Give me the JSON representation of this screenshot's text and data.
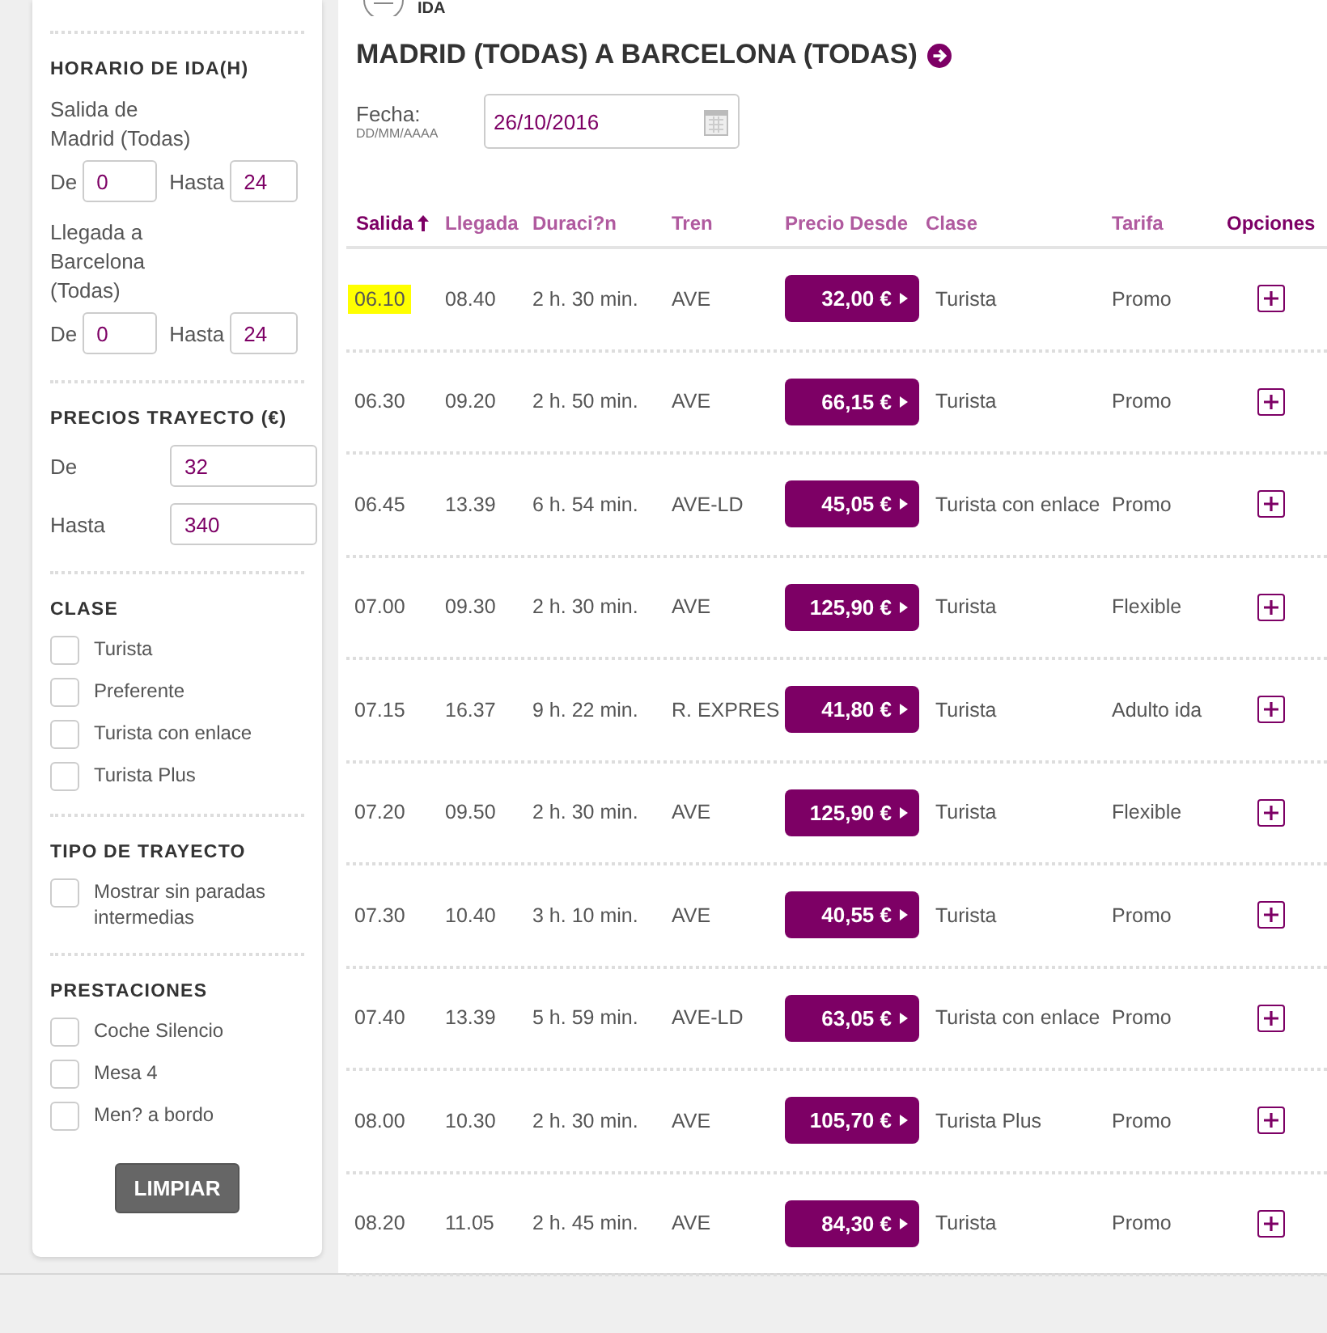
{
  "header": {
    "label": "IDA"
  },
  "route": {
    "title": "MADRID (TODAS) A BARCELONA (TODAS)"
  },
  "date": {
    "label": "Fecha:",
    "format": "DD/MM/AAAA",
    "value": "26/10/2016"
  },
  "filters": [
    {
      "kind": "hours",
      "title": "HORARIO DE IDA(H)",
      "groups": [
        {
          "label": "Salida de Madrid (Todas)",
          "from_label": "De",
          "from": "0",
          "to_label": "Hasta",
          "to": "24"
        },
        {
          "label": "Llegada a Barcelona (Todas)",
          "from_label": "De",
          "from": "0",
          "to_label": "Hasta",
          "to": "24"
        }
      ]
    },
    {
      "kind": "prices",
      "title": "PRECIOS TRAYECTO (€)",
      "fields": [
        {
          "label": "De",
          "value": "32"
        },
        {
          "label": "Hasta",
          "value": "340"
        }
      ]
    },
    {
      "kind": "checks",
      "title": "CLASE",
      "options": [
        {
          "label": "Turista",
          "checked": false
        },
        {
          "label": "Preferente",
          "checked": false
        },
        {
          "label": "Turista con enlace",
          "checked": false
        },
        {
          "label": "Turista Plus",
          "checked": false
        }
      ]
    },
    {
      "kind": "checks",
      "title": "TIPO DE TRAYECTO",
      "options": [
        {
          "label": "Mostrar sin paradas intermedias",
          "checked": false
        }
      ]
    },
    {
      "kind": "checks",
      "title": "PRESTACIONES",
      "options": [
        {
          "label": "Coche Silencio",
          "checked": false
        },
        {
          "label": "Mesa 4",
          "checked": false
        },
        {
          "label": "Men? a bordo",
          "checked": false
        }
      ]
    }
  ],
  "clear_button": "LIMPIAR",
  "table": {
    "columns": [
      {
        "label": "Salida",
        "sorted": true,
        "bold": true
      },
      {
        "label": "Llegada",
        "sorted": false,
        "bold": false
      },
      {
        "label": "Duraci?n",
        "sorted": false,
        "bold": false
      },
      {
        "label": "Tren",
        "sorted": false,
        "bold": false
      },
      {
        "label": "Precio Desde",
        "sorted": false,
        "bold": false
      },
      {
        "label": "Clase",
        "sorted": false,
        "bold": false
      },
      {
        "label": "Tarifa",
        "sorted": false,
        "bold": false
      },
      {
        "label": "Opciones",
        "sorted": false,
        "bold": true
      }
    ],
    "rows": [
      {
        "departure": "06.10",
        "highlighted": true,
        "arrival": "08.40",
        "duration": "2 h. 30 min.",
        "train": "AVE",
        "price": "32,00 €",
        "class": "Turista",
        "fare": "Promo"
      },
      {
        "departure": "06.30",
        "highlighted": false,
        "arrival": "09.20",
        "duration": "2 h. 50 min.",
        "train": "AVE",
        "price": "66,15 €",
        "class": "Turista",
        "fare": "Promo"
      },
      {
        "departure": "06.45",
        "highlighted": false,
        "arrival": "13.39",
        "duration": "6 h. 54 min.",
        "train": "AVE-LD",
        "price": "45,05 €",
        "class": "Turista con enlace",
        "fare": "Promo"
      },
      {
        "departure": "07.00",
        "highlighted": false,
        "arrival": "09.30",
        "duration": "2 h. 30 min.",
        "train": "AVE",
        "price": "125,90 €",
        "class": "Turista",
        "fare": "Flexible"
      },
      {
        "departure": "07.15",
        "highlighted": false,
        "arrival": "16.37",
        "duration": "9 h. 22 min.",
        "train": "R. EXPRES",
        "price": "41,80 €",
        "class": "Turista",
        "fare": "Adulto ida"
      },
      {
        "departure": "07.20",
        "highlighted": false,
        "arrival": "09.50",
        "duration": "2 h. 30 min.",
        "train": "AVE",
        "price": "125,90 €",
        "class": "Turista",
        "fare": "Flexible"
      },
      {
        "departure": "07.30",
        "highlighted": false,
        "arrival": "10.40",
        "duration": "3 h. 10 min.",
        "train": "AVE",
        "price": "40,55 €",
        "class": "Turista",
        "fare": "Promo"
      },
      {
        "departure": "07.40",
        "highlighted": false,
        "arrival": "13.39",
        "duration": "5 h. 59 min.",
        "train": "AVE-LD",
        "price": "63,05 €",
        "class": "Turista con enlace",
        "fare": "Promo"
      },
      {
        "departure": "08.00",
        "highlighted": false,
        "arrival": "10.30",
        "duration": "2 h. 30 min.",
        "train": "AVE",
        "price": "105,70 €",
        "class": "Turista Plus",
        "fare": "Promo"
      },
      {
        "departure": "08.20",
        "highlighted": false,
        "arrival": "11.05",
        "duration": "2 h. 45 min.",
        "train": "AVE",
        "price": "84,30 €",
        "class": "Turista",
        "fare": "Promo"
      }
    ]
  }
}
